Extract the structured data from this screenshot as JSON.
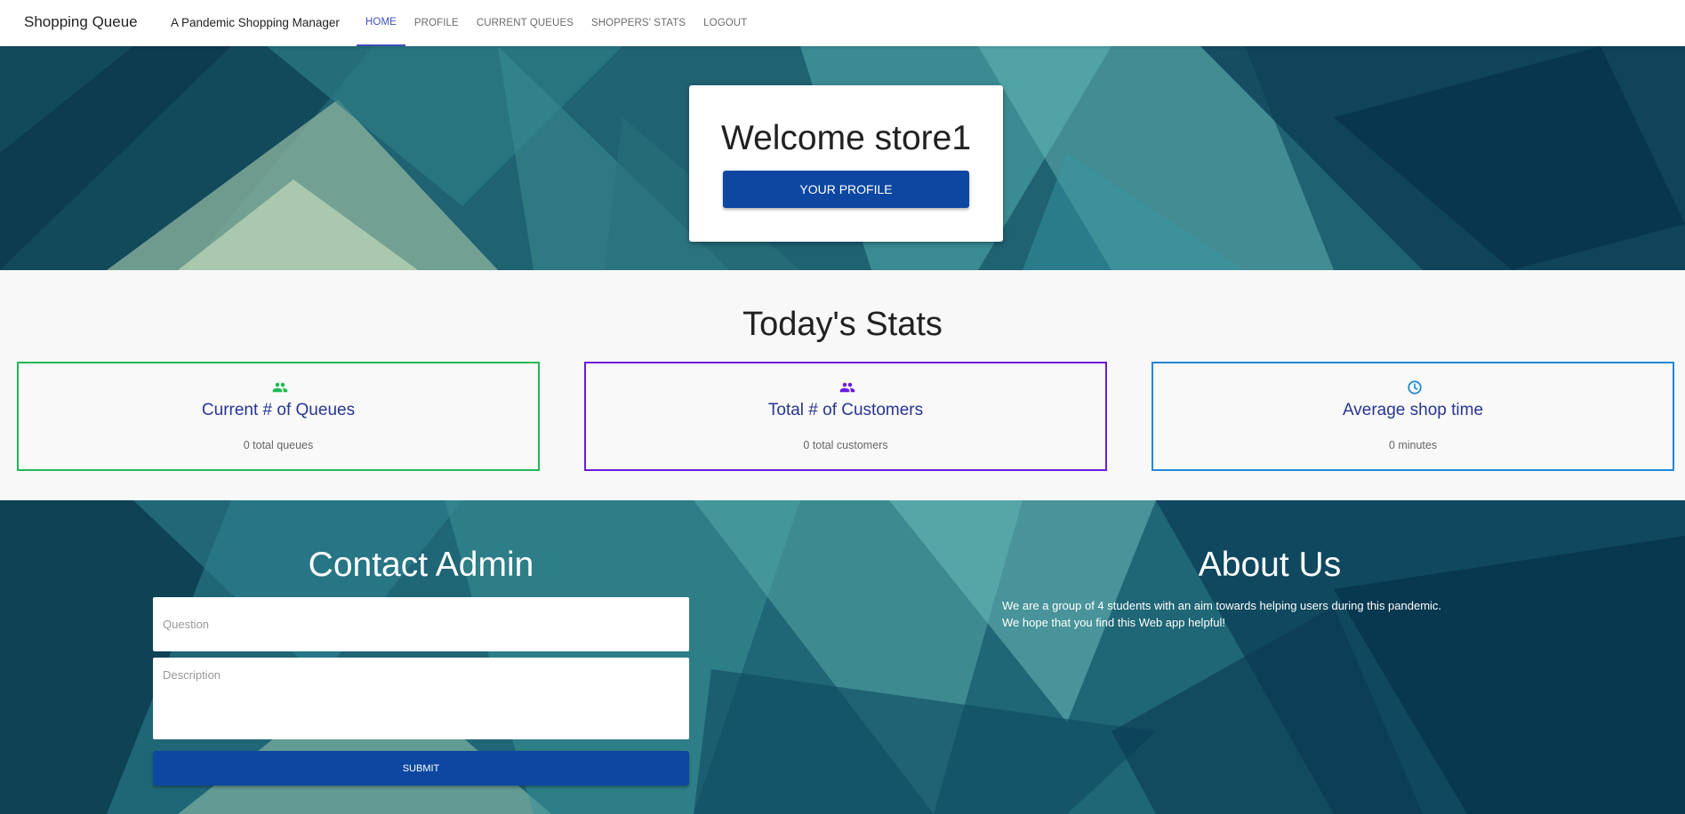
{
  "nav": {
    "brand": "Shopping Queue",
    "tagline": "A Pandemic Shopping Manager",
    "links": [
      "HOME",
      "PROFILE",
      "CURRENT QUEUES",
      "SHOPPERS' STATS",
      "LOGOUT"
    ],
    "active": "HOME"
  },
  "hero": {
    "welcome": "Welcome store1",
    "profile_button": "YOUR PROFILE"
  },
  "stats": {
    "title": "Today's Stats",
    "cards": [
      {
        "icon": "people-icon",
        "title": "Current # of Queues",
        "value": "0 total queues",
        "color": "#1db954"
      },
      {
        "icon": "people-icon",
        "title": "Total # of Customers",
        "value": "0 total customers",
        "color": "#6a1be0"
      },
      {
        "icon": "clock-icon",
        "title": "Average shop time",
        "value": "0 minutes",
        "color": "#1e88d8"
      }
    ]
  },
  "contact": {
    "title": "Contact Admin",
    "question_placeholder": "Question",
    "description_placeholder": "Description",
    "submit": "SUBMIT"
  },
  "about": {
    "title": "About Us",
    "lines": [
      "We are a group of 4 students with an aim towards helping users during this pandemic.",
      "We hope that you find this Web app helpful!"
    ]
  },
  "colors": {
    "primary_button": "#0d47a1",
    "nav_active": "#3f51b5",
    "stat_title": "#283593"
  }
}
